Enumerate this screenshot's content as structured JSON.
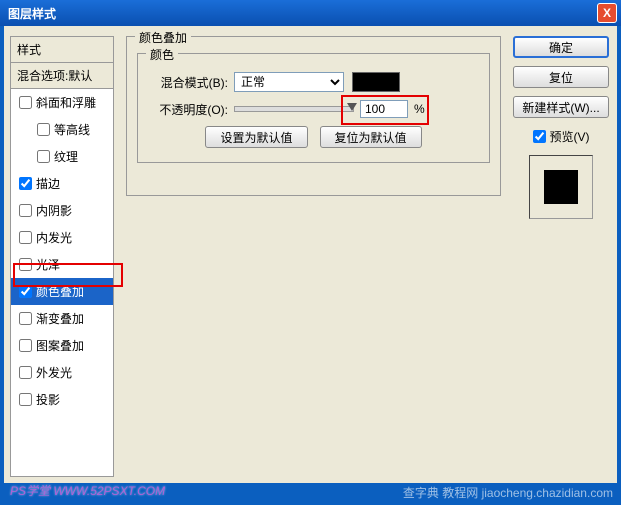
{
  "window": {
    "title": "图层样式",
    "close": "X"
  },
  "styles": {
    "header": "样式",
    "blend_options": "混合选项:默认",
    "items": [
      {
        "label": "斜面和浮雕",
        "checked": false,
        "indent": false
      },
      {
        "label": "等高线",
        "checked": false,
        "indent": true
      },
      {
        "label": "纹理",
        "checked": false,
        "indent": true
      },
      {
        "label": "描边",
        "checked": true,
        "indent": false
      },
      {
        "label": "内阴影",
        "checked": false,
        "indent": false
      },
      {
        "label": "内发光",
        "checked": false,
        "indent": false
      },
      {
        "label": "光泽",
        "checked": false,
        "indent": false
      },
      {
        "label": "颜色叠加",
        "checked": true,
        "indent": false,
        "selected": true
      },
      {
        "label": "渐变叠加",
        "checked": false,
        "indent": false
      },
      {
        "label": "图案叠加",
        "checked": false,
        "indent": false
      },
      {
        "label": "外发光",
        "checked": false,
        "indent": false
      },
      {
        "label": "投影",
        "checked": false,
        "indent": false
      }
    ]
  },
  "panel": {
    "title": "颜色叠加",
    "group_title": "颜色",
    "blend_mode_label": "混合模式(B):",
    "blend_mode_value": "正常",
    "opacity_label": "不透明度(O):",
    "opacity_value": "100",
    "opacity_suffix": "%",
    "set_default": "设置为默认值",
    "reset_default": "复位为默认值"
  },
  "buttons": {
    "ok": "确定",
    "cancel": "复位",
    "new_style": "新建样式(W)...",
    "preview": "预览(V)"
  },
  "watermark_left": "PS学堂  WWW.52PSXT.COM",
  "watermark_right": "查字典  教程网  jiaocheng.chazidian.com"
}
